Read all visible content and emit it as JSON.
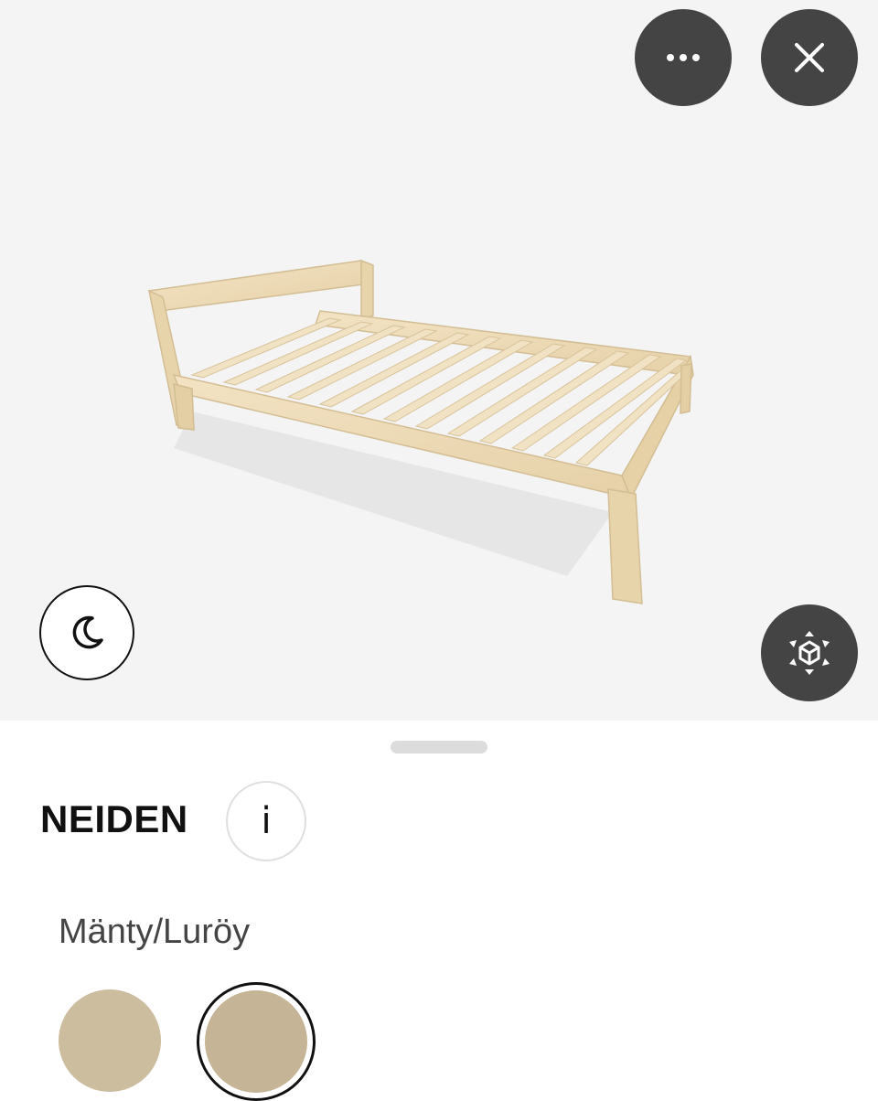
{
  "viewer": {
    "more_button_icon": "more-horizontal-icon",
    "close_button_icon": "close-icon",
    "night_mode_icon": "moon-icon",
    "ar_view_icon": "ar-cube-icon",
    "background_color": "#f4f4f4"
  },
  "product": {
    "name": "NEIDEN",
    "info_label": "i",
    "variant": "Mänty/Luröy",
    "swatches": [
      {
        "color": "#cdbd9f",
        "selected": false
      },
      {
        "color": "#c5b596",
        "selected": true
      }
    ]
  }
}
